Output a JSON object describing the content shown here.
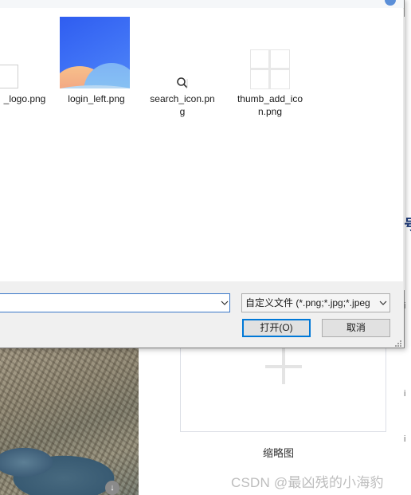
{
  "files": [
    {
      "name": "_logo.png"
    },
    {
      "name": "login_left.png"
    },
    {
      "name": "search_icon.pn g"
    },
    {
      "name": "thumb_add_ico n.png"
    }
  ],
  "controls": {
    "filename_value": "",
    "filetype_value": "自定义文件 (*.png;*.jpg;*.jpeg",
    "open_label": "打开(O)",
    "cancel_label": "取消"
  },
  "background": {
    "thumbnail_label": "缩略图",
    "watermark": "CSDN @最凶残的小海豹",
    "side_marks": [
      "号",
      "i",
      "i",
      "i"
    ]
  },
  "colors": {
    "accent": "#0078d7",
    "dialog_bg": "#f0f0f0"
  }
}
